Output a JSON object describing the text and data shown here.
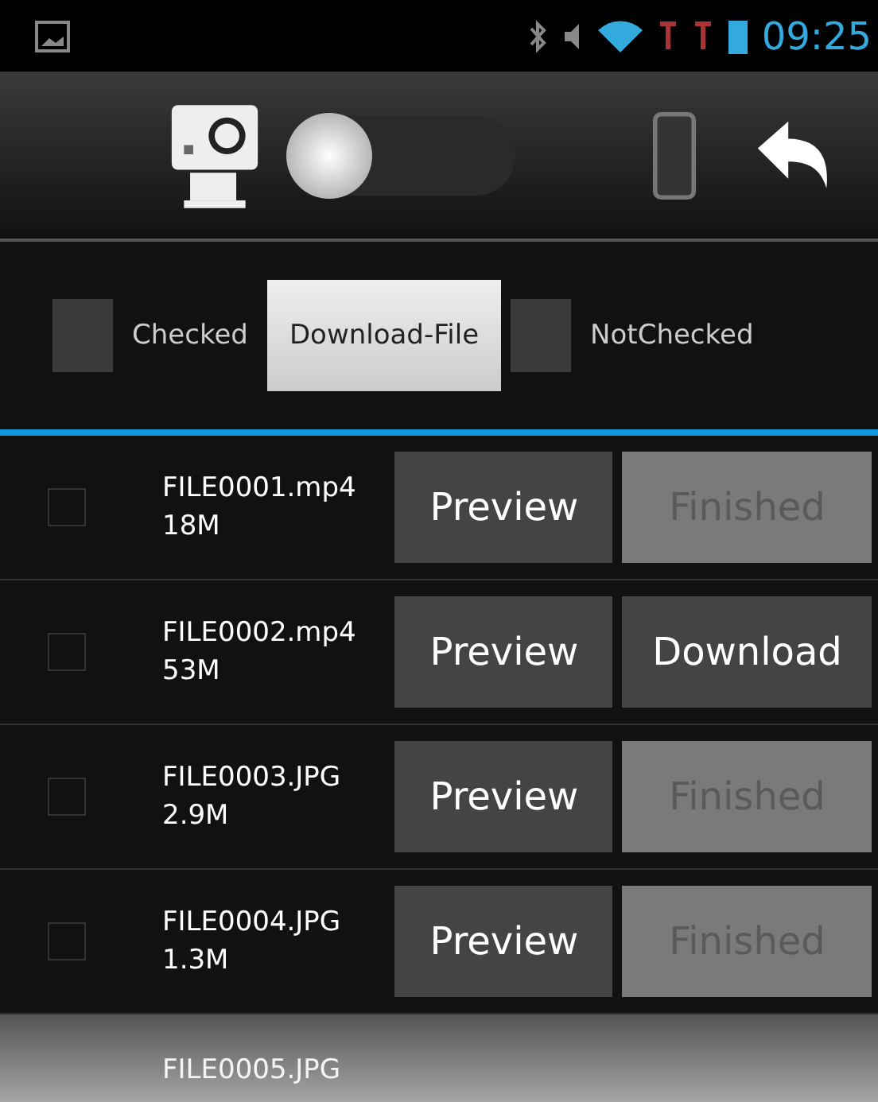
{
  "status_bar": {
    "time": "09:25"
  },
  "toolbar": {
    "switch": {
      "on": false
    }
  },
  "filter_bar": {
    "checked": {
      "label": "Checked",
      "checked": false
    },
    "button": "Download-File",
    "not_checked": {
      "label": "NotChecked",
      "checked": false
    }
  },
  "files": [
    {
      "name": "FILE0001.mp4",
      "size": "18M",
      "checked": false,
      "preview": "Preview",
      "action": {
        "label": "Finished",
        "disabled": true
      }
    },
    {
      "name": "FILE0002.mp4",
      "size": "53M",
      "checked": false,
      "preview": "Preview",
      "action": {
        "label": "Download",
        "disabled": false
      }
    },
    {
      "name": "FILE0003.JPG",
      "size": "2.9M",
      "checked": false,
      "preview": "Preview",
      "action": {
        "label": "Finished",
        "disabled": true
      }
    },
    {
      "name": "FILE0004.JPG",
      "size": "1.3M",
      "checked": false,
      "preview": "Preview",
      "action": {
        "label": "Finished",
        "disabled": true
      }
    },
    {
      "name": "FILE0005.JPG"
    }
  ]
}
